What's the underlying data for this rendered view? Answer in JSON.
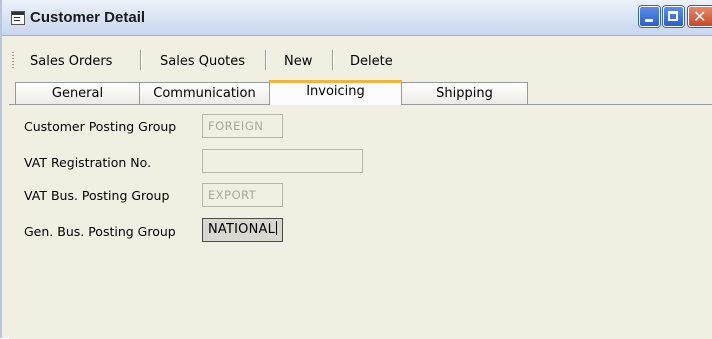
{
  "window": {
    "title": "Customer Detail"
  },
  "toolbar": {
    "items": [
      "Sales Orders",
      "Sales Quotes",
      "New",
      "Delete"
    ]
  },
  "tabs": {
    "items": [
      "General",
      "Communication",
      "Invoicing",
      "Shipping"
    ],
    "active": "Invoicing"
  },
  "form": {
    "fields": [
      {
        "label": "Customer Posting Group",
        "value": "FOREIGN"
      },
      {
        "label": "VAT Registration No.",
        "value": ""
      },
      {
        "label": "VAT Bus. Posting Group",
        "value": "EXPORT"
      },
      {
        "label": "Gen. Bus. Posting Group",
        "value": "NATIONAL"
      }
    ]
  }
}
